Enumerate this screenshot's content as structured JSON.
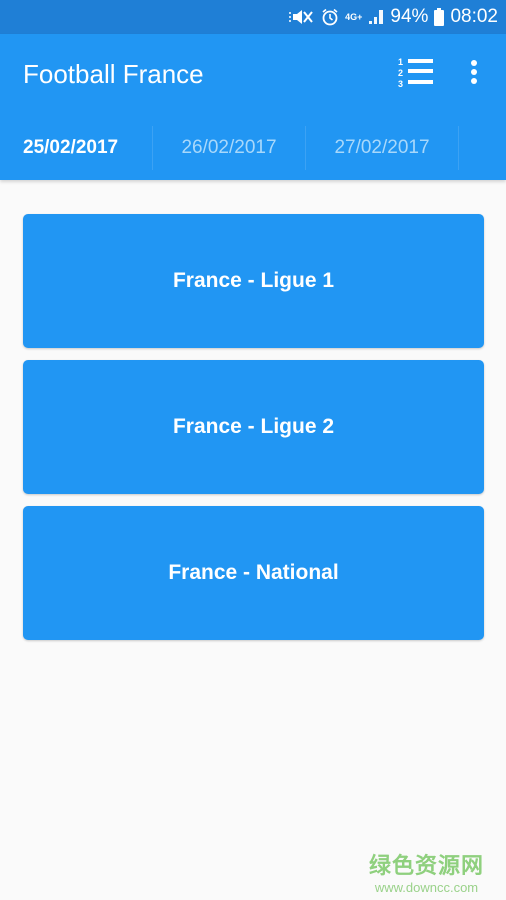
{
  "status_bar": {
    "icons": [
      "mute-icon",
      "alarm-icon",
      "network-4g-icon",
      "signal-icon"
    ],
    "network_label": "4G+",
    "battery_percent": "94%",
    "time": "08:02"
  },
  "app_bar": {
    "title": "Football France",
    "actions": [
      "standings-icon",
      "overflow-menu-icon"
    ],
    "standings_numbers": [
      "1",
      "2",
      "3"
    ]
  },
  "date_tabs": [
    {
      "label": "25/02/2017",
      "active": true
    },
    {
      "label": "26/02/2017",
      "active": false
    },
    {
      "label": "27/02/2017",
      "active": false
    }
  ],
  "leagues": [
    {
      "label": "France - Ligue 1"
    },
    {
      "label": "France - Ligue 2"
    },
    {
      "label": "France - National"
    }
  ],
  "watermark": {
    "name": "绿色资源网",
    "url": "www.downcc.com"
  },
  "colors": {
    "primary": "#2196f3",
    "status_bar": "#1f7fd6",
    "background": "#fafafa"
  }
}
